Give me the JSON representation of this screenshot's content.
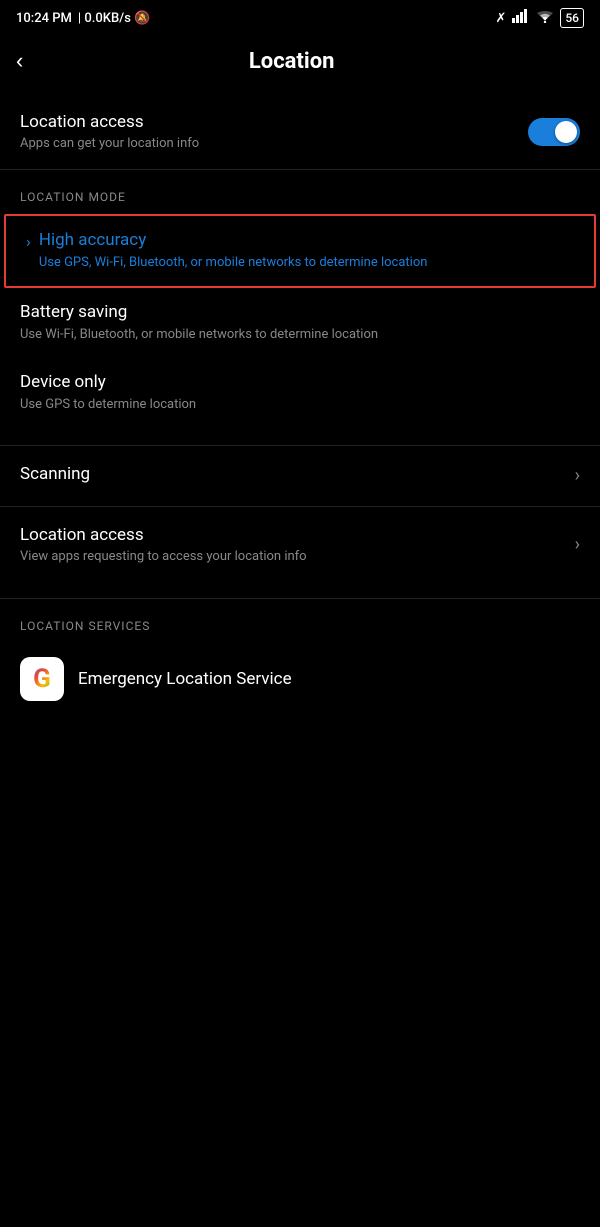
{
  "statusBar": {
    "time": "10:24 PM",
    "network": "0.0KB/s",
    "battery": "56"
  },
  "header": {
    "back": "<",
    "title": "Location"
  },
  "locationAccess": {
    "label": "Location access",
    "description": "Apps can get your location info",
    "toggleOn": true
  },
  "locationMode": {
    "sectionLabel": "LOCATION MODE",
    "modes": [
      {
        "id": "high-accuracy",
        "title": "High accuracy",
        "description": "Use GPS, Wi-Fi, Bluetooth, or mobile networks to determine location",
        "selected": true,
        "color": "blue"
      },
      {
        "id": "battery-saving",
        "title": "Battery saving",
        "description": "Use Wi-Fi, Bluetooth, or mobile networks to determine location",
        "selected": false,
        "color": "white"
      },
      {
        "id": "device-only",
        "title": "Device only",
        "description": "Use GPS to determine location",
        "selected": false,
        "color": "white"
      }
    ]
  },
  "navItems": [
    {
      "id": "scanning",
      "title": "Scanning",
      "description": ""
    },
    {
      "id": "location-access",
      "title": "Location access",
      "description": "View apps requesting to access your location info"
    }
  ],
  "locationServices": {
    "sectionLabel": "LOCATION SERVICES",
    "items": [
      {
        "id": "emergency-location",
        "icon": "google",
        "title": "Emergency Location Service"
      }
    ]
  }
}
